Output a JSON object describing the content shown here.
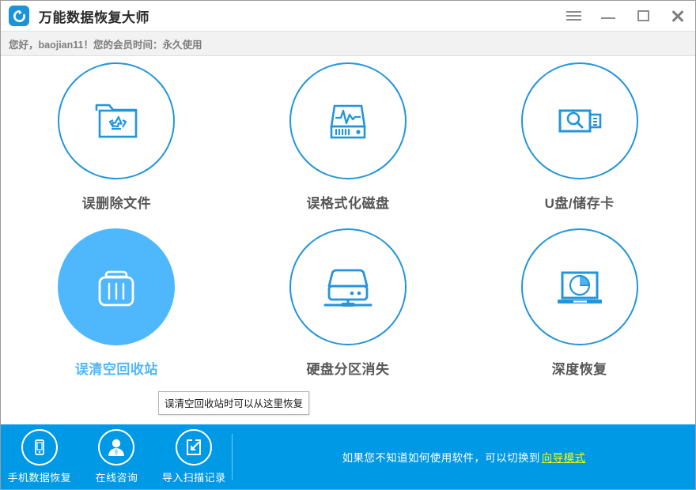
{
  "window": {
    "app_title": "万能数据恢复大师",
    "logo_icon": "recovery-refresh-icon",
    "controls": [
      {
        "name": "menu-button",
        "icon": "hamburger-menu-icon"
      },
      {
        "name": "minimize-button",
        "icon": "minimize-icon"
      },
      {
        "name": "maximize-button",
        "icon": "maximize-icon"
      },
      {
        "name": "close-button",
        "icon": "close-icon"
      }
    ]
  },
  "greeting": {
    "text": "您好，baojian11！您的会员时间：永久使用"
  },
  "main": {
    "cards": [
      {
        "label": "误删除文件",
        "icon": "folder-recycle-icon",
        "active": false
      },
      {
        "label": "误格式化磁盘",
        "icon": "disk-waveform-icon",
        "active": false
      },
      {
        "label": "U盘/储存卡",
        "icon": "usb-drive-search-icon",
        "active": false
      },
      {
        "label": "误清空回收站",
        "icon": "trash-bin-icon",
        "active": true
      },
      {
        "label": "硬盘分区消失",
        "icon": "external-hard-drive-icon",
        "active": false
      },
      {
        "label": "深度恢复",
        "icon": "laptop-pie-chart-icon",
        "active": false
      }
    ],
    "tooltip": {
      "text": "误清空回收站时可以从这里恢复"
    }
  },
  "bottom": {
    "actions": [
      {
        "label": "手机数据恢复",
        "icon": "mobile-phone-icon"
      },
      {
        "label": "在线咨询",
        "icon": "user-person-icon"
      },
      {
        "label": "导入扫描记录",
        "icon": "import-arrow-icon"
      }
    ],
    "hint_text": "如果您不知道如何使用软件，可以切换到",
    "hint_link": "向导模式"
  },
  "colors": {
    "accent_blue": "#0099e5",
    "outline_blue": "#2395db",
    "active_blue": "#4fb8fc",
    "link_yellow": "#fffb00",
    "label_gray": "#575757"
  }
}
